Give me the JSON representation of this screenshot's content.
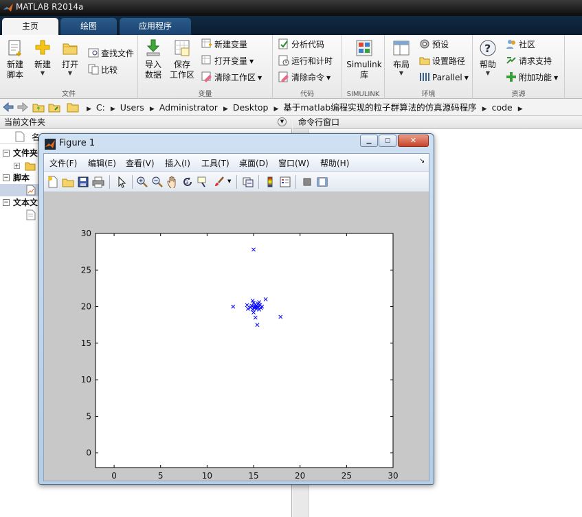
{
  "app": {
    "title": "MATLAB R2014a"
  },
  "ribbon_tabs": [
    "主页",
    "绘图",
    "应用程序"
  ],
  "ribbon": {
    "file": {
      "label": "文件",
      "new_script": "新建\n脚本",
      "new": "新建",
      "open": "打开",
      "find_files": "查找文件",
      "compare": "比较"
    },
    "variable": {
      "label": "变量",
      "import": "导入\n数据",
      "save_ws": "保存\n工作区",
      "new_var": "新建变量",
      "open_var": "打开变量",
      "clear_ws": "清除工作区"
    },
    "code": {
      "label": "代码",
      "analyze": "分析代码",
      "run_time": "运行和计时",
      "clear_cmd": "清除命令"
    },
    "simulink": {
      "label": "SIMULINK",
      "lib": "Simulink\n库"
    },
    "environment": {
      "label": "环境",
      "layout": "布局",
      "prefs": "预设",
      "set_path": "设置路径",
      "parallel": "Parallel"
    },
    "resources": {
      "label": "资源",
      "help": "帮助",
      "community": "社区",
      "support": "请求支持",
      "addons": "附加功能"
    }
  },
  "address": {
    "crumbs": [
      "C:",
      "Users",
      "Administrator",
      "Desktop",
      "基于matlab编程实现的粒子群算法的仿真源码程序",
      "code"
    ]
  },
  "left_panel": {
    "title": "当前文件夹",
    "column_name": "名",
    "tree": [
      "文件夹",
      "脚本",
      "文本文"
    ]
  },
  "command_window": {
    "title": "命令行窗口"
  },
  "figure": {
    "title": "Figure 1",
    "menus": [
      "文件(F)",
      "编辑(E)",
      "查看(V)",
      "插入(I)",
      "工具(T)",
      "桌面(D)",
      "窗口(W)",
      "帮助(H)"
    ],
    "toolbar": [
      "new-figure-icon",
      "open-file-icon",
      "save-icon",
      "print-icon",
      "pointer-icon",
      "zoom-in-icon",
      "zoom-out-icon",
      "pan-hand-icon",
      "rotate-3d-icon",
      "data-cursor-icon",
      "brush-icon",
      "link-plot-icon",
      "colorbar-icon",
      "legend-icon",
      "hide-plot-tools-icon",
      "show-plot-tools-icon"
    ]
  },
  "chart_data": {
    "type": "scatter",
    "marker": "x",
    "color": "#0000ff",
    "xlim": [
      -2,
      30
    ],
    "ylim": [
      -2,
      30
    ],
    "xticks": [
      0,
      5,
      10,
      15,
      20,
      25,
      30
    ],
    "yticks": [
      0,
      5,
      10,
      15,
      20,
      25,
      30
    ],
    "points": [
      [
        15.0,
        27.8
      ],
      [
        12.8,
        20.0
      ],
      [
        14.3,
        20.2
      ],
      [
        14.4,
        19.7
      ],
      [
        14.8,
        20.1
      ],
      [
        14.9,
        19.6
      ],
      [
        15.0,
        20.5
      ],
      [
        15.1,
        20.0
      ],
      [
        15.1,
        19.8
      ],
      [
        15.2,
        20.3
      ],
      [
        15.2,
        19.9
      ],
      [
        15.3,
        20.1
      ],
      [
        15.3,
        19.7
      ],
      [
        15.4,
        20.0
      ],
      [
        15.5,
        20.4
      ],
      [
        15.5,
        19.9
      ],
      [
        15.6,
        19.6
      ],
      [
        15.7,
        20.2
      ],
      [
        15.8,
        19.8
      ],
      [
        15.0,
        19.2
      ],
      [
        15.2,
        18.5
      ],
      [
        15.4,
        17.5
      ],
      [
        16.3,
        21.0
      ],
      [
        17.9,
        18.6
      ],
      [
        14.9,
        20.8
      ],
      [
        15.6,
        20.6
      ],
      [
        15.9,
        20.0
      ],
      [
        14.7,
        19.9
      ]
    ]
  }
}
